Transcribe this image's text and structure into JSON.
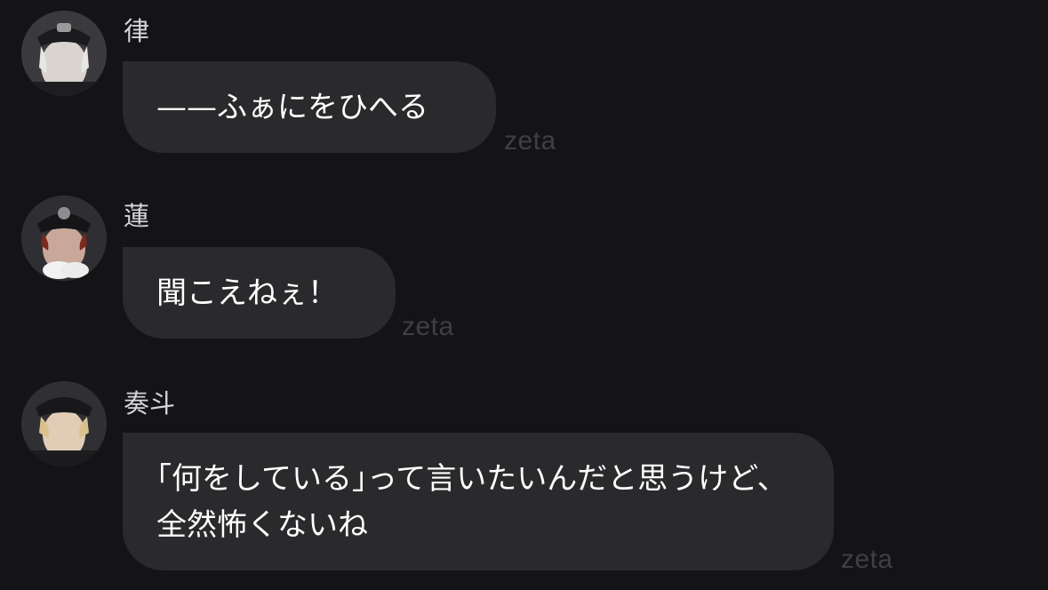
{
  "messages": [
    {
      "name": "律",
      "text": "——ふぁにをひへる",
      "watermark": "zeta"
    },
    {
      "name": "蓮",
      "text": "聞こえねぇ！",
      "watermark": "zeta"
    },
    {
      "name": "奏斗",
      "text": "｢何をしている｣って言いたいんだと思うけど、全然怖くないね",
      "watermark": "zeta"
    }
  ],
  "colors": {
    "background": "#141416",
    "bubble": "#2a2a2d",
    "name_text": "#d6d6d8",
    "message_text": "#ffffff",
    "watermark": "#3f3f44"
  }
}
